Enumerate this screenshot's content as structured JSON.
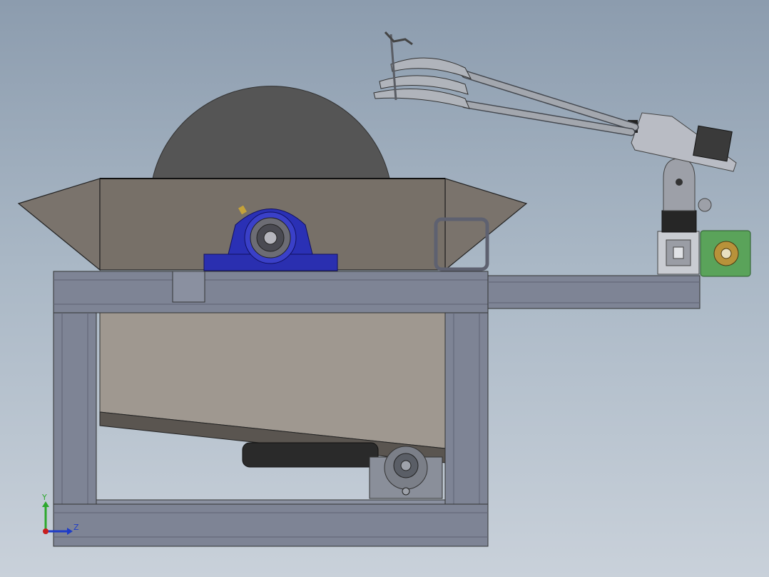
{
  "triad": {
    "y_label": "Y",
    "z_label": "Z"
  },
  "colors": {
    "background_top": "#8c9cae",
    "background_bottom": "#c9d1da",
    "frame": "#7e8495",
    "frame_dark": "#5d6272",
    "hopper": "#777068",
    "blade": "#555555",
    "bearing_housing": "#2a2fb0",
    "motor_plate": "#5aa35a",
    "triad_y": "#2da82d",
    "triad_z": "#1e3cc8",
    "triad_x": "#c81e1e"
  }
}
